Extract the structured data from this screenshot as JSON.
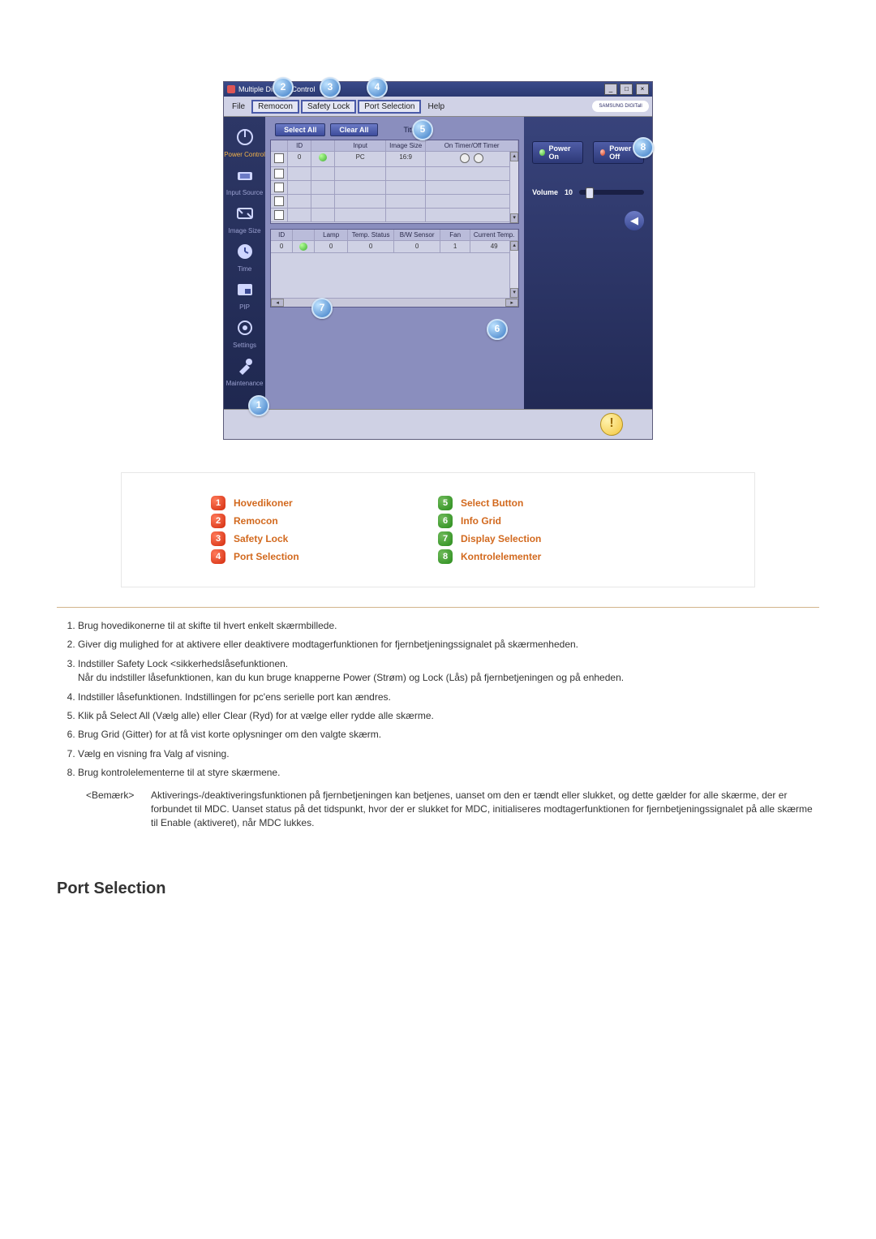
{
  "app": {
    "title": "Multiple Display Control",
    "menus": [
      "File",
      "Remocon",
      "Safety Lock",
      "Port Selection",
      "Help"
    ],
    "brand": "SAMSUNG DIGITall",
    "selectAll": "Select All",
    "clearAll": "Clear All",
    "toolbarTitle": "Title"
  },
  "sidebar": {
    "items": [
      {
        "label": "Power Control"
      },
      {
        "label": "Input Source"
      },
      {
        "label": "Image Size"
      },
      {
        "label": "Time"
      },
      {
        "label": "PIP"
      },
      {
        "label": "Settings"
      },
      {
        "label": "Maintenance"
      }
    ]
  },
  "grid1": {
    "headers": [
      "",
      "ID",
      "",
      "Input",
      "Image Size",
      "On Timer/Off Timer"
    ],
    "row": {
      "id": "0",
      "input": "PC",
      "imageSize": "16:9"
    }
  },
  "grid2": {
    "headers": [
      "ID",
      "",
      "Lamp",
      "Temp. Status",
      "B/W Sensor",
      "Fan",
      "Current Temp."
    ],
    "row": {
      "id": "0",
      "lamp": "0",
      "temp": "0",
      "bw": "0",
      "fan": "1",
      "ct": "49"
    }
  },
  "panel": {
    "powerOn": "Power On",
    "powerOff": "Power Off",
    "volumeLabel": "Volume",
    "volumeValue": "10"
  },
  "callouts": {
    "c1": "1",
    "c2": "2",
    "c3": "3",
    "c4": "4",
    "c5": "5",
    "c6": "6",
    "c7": "7",
    "c8": "8"
  },
  "legend": {
    "left": [
      {
        "n": "1",
        "label": "Hovedikoner"
      },
      {
        "n": "2",
        "label": "Remocon"
      },
      {
        "n": "3",
        "label": "Safety Lock"
      },
      {
        "n": "4",
        "label": "Port Selection"
      }
    ],
    "right": [
      {
        "n": "5",
        "label": "Select Button"
      },
      {
        "n": "6",
        "label": "Info Grid"
      },
      {
        "n": "7",
        "label": "Display Selection"
      },
      {
        "n": "8",
        "label": "Kontrolelementer"
      }
    ]
  },
  "desc": {
    "i1": "Brug hovedikonerne til at skifte til hvert enkelt skærmbillede.",
    "i2": "Giver dig mulighed for at aktivere eller deaktivere modtagerfunktionen for fjernbetjeningssignalet på skærmenheden.",
    "i3a": "Indstiller Safety Lock <sikkerhedslåsefunktionen.",
    "i3b": "Når du indstiller låsefunktionen, kan du kun bruge knapperne Power (Strøm) og Lock (Lås) på fjernbetjeningen og på enheden.",
    "i4": "Indstiller låsefunktionen. Indstillingen for pc'ens serielle port kan ændres.",
    "i5": "Klik på Select All (Vælg alle) eller Clear (Ryd) for at vælge eller rydde alle skærme.",
    "i6": "Brug Grid (Gitter) for at få vist korte oplysninger om den valgte skærm.",
    "i7": "Vælg en visning fra Valg af visning.",
    "i8": "Brug kontrolelementerne til at styre skærmene."
  },
  "note": {
    "label": "<Bemærk>",
    "body": "Aktiverings-/deaktiveringsfunktionen på fjernbetjeningen kan betjenes, uanset om den er tændt eller slukket, og dette gælder for alle skærme, der er forbundet til MDC. Uanset status på det tidspunkt, hvor der er slukket for MDC, initialiseres modtagerfunktionen for fjernbetjeningssignalet på alle skærme til Enable (aktiveret), når MDC lukkes."
  },
  "sectionHeading": "Port Selection"
}
